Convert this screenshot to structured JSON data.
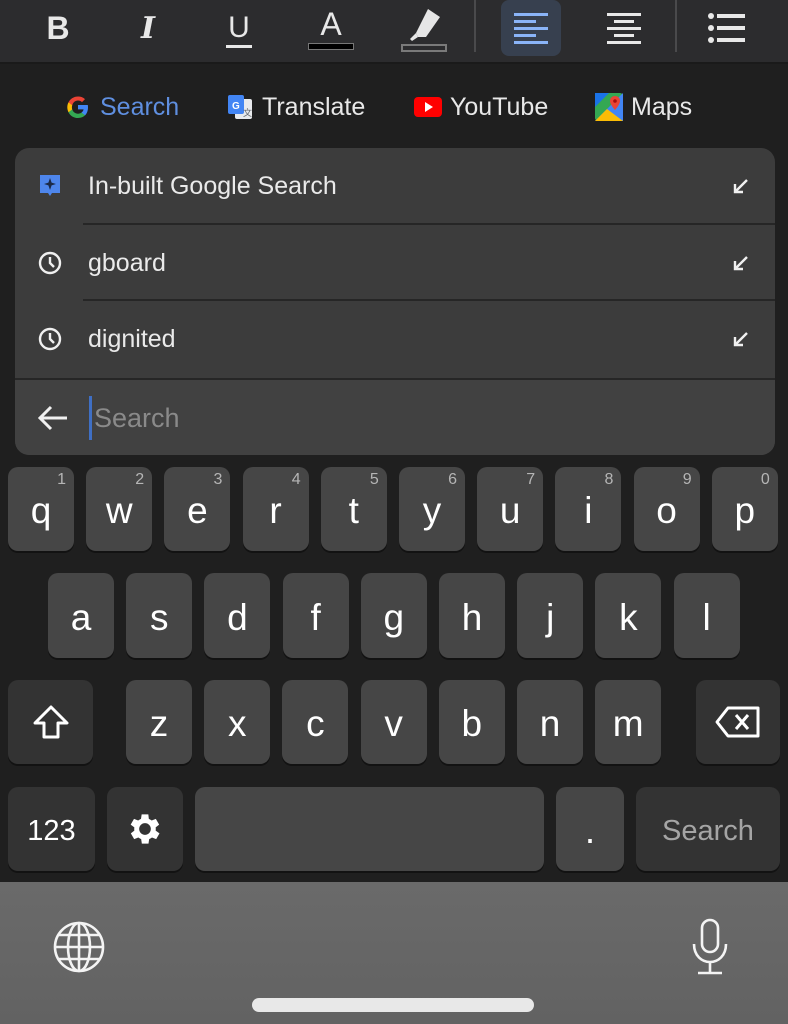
{
  "toolbar": {
    "buttons": [
      {
        "name": "bold",
        "label": "B"
      },
      {
        "name": "italic",
        "label": "I"
      },
      {
        "name": "underline",
        "label": "U"
      },
      {
        "name": "text-color",
        "label": "A"
      },
      {
        "name": "highlight",
        "label": ""
      },
      {
        "name": "align-left",
        "label": "",
        "active": true
      },
      {
        "name": "align-center",
        "label": ""
      },
      {
        "name": "bulleted-list",
        "label": ""
      }
    ],
    "active_color": "#8ab4f8"
  },
  "shortcuts": [
    {
      "label": "Search",
      "icon": "google-g-icon",
      "active": true
    },
    {
      "label": "Translate",
      "icon": "google-translate-icon"
    },
    {
      "label": "YouTube",
      "icon": "youtube-icon"
    },
    {
      "label": "Maps",
      "icon": "google-maps-icon"
    }
  ],
  "suggestions": [
    {
      "text": "In-built Google Search",
      "icon": "sparkle-badge-icon",
      "action": "fill-arrow-icon"
    },
    {
      "text": "gboard",
      "icon": "history-clock-icon",
      "action": "fill-arrow-icon"
    },
    {
      "text": "dignited",
      "icon": "history-clock-icon",
      "action": "fill-arrow-icon"
    }
  ],
  "search": {
    "value": "",
    "placeholder": "Search"
  },
  "keyboard": {
    "row1": [
      {
        "ch": "q",
        "hint": "1"
      },
      {
        "ch": "w",
        "hint": "2"
      },
      {
        "ch": "e",
        "hint": "3"
      },
      {
        "ch": "r",
        "hint": "4"
      },
      {
        "ch": "t",
        "hint": "5"
      },
      {
        "ch": "y",
        "hint": "6"
      },
      {
        "ch": "u",
        "hint": "7"
      },
      {
        "ch": "i",
        "hint": "8"
      },
      {
        "ch": "o",
        "hint": "9"
      },
      {
        "ch": "p",
        "hint": "0"
      }
    ],
    "row2": [
      "a",
      "s",
      "d",
      "f",
      "g",
      "h",
      "j",
      "k",
      "l"
    ],
    "row3": [
      "z",
      "x",
      "c",
      "v",
      "b",
      "n",
      "m"
    ],
    "numbers_label": "123",
    "period_label": ".",
    "action_label": "Search",
    "shift_icon": "shift-arrow-icon",
    "backspace_icon": "backspace-icon",
    "settings_icon": "gear-icon"
  },
  "system_bar": {
    "left_icon": "globe-icon",
    "right_icon": "microphone-icon"
  }
}
